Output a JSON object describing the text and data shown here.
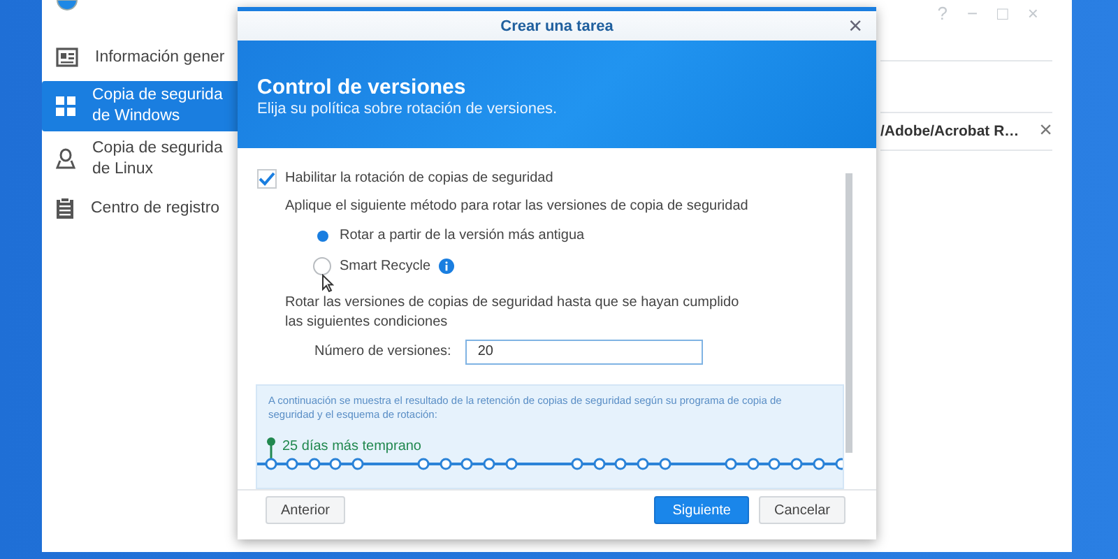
{
  "window": {
    "controls": [
      "?",
      "−",
      "□",
      "×"
    ]
  },
  "sidebar": {
    "items": [
      {
        "label": "Información gener",
        "kind": "card",
        "selected": false
      },
      {
        "label": "Copia de segurida\nde Windows",
        "kind": "windows",
        "selected": true
      },
      {
        "label": "Copia de segurida\nde Linux",
        "kind": "linux",
        "selected": false
      },
      {
        "label": "Centro de registro",
        "kind": "clipboard",
        "selected": false
      }
    ]
  },
  "main": {
    "rows": [
      {
        "path": "/Adobe/Acrobat R…"
      }
    ]
  },
  "dialog": {
    "title": "Crear una tarea",
    "close": "×",
    "banner": {
      "title": "Control de versiones",
      "subtitle": "Elija su política sobre rotación de versiones."
    },
    "enable": {
      "label": "Habilitar la rotación de copias de seguridad",
      "checked": true
    },
    "method_label": "Aplique el siguiente método para rotar las versiones de copia de seguridad",
    "methods": [
      {
        "label": "Rotar a partir de la versión más antigua",
        "selected": true,
        "info": false
      },
      {
        "label": "Smart Recycle",
        "selected": false,
        "info": true
      }
    ],
    "condition_text": "Rotar las versiones de copias de seguridad hasta que se hayan cumplido las siguientes condiciones",
    "versions": {
      "label": "Número de versiones:",
      "value": "20"
    },
    "preview": {
      "text": "A continuación se muestra el resultado de la retención de copias de seguridad según su programa de copia de seguridad y el esquema de rotación:",
      "marker": "25 días más temprano"
    },
    "buttons": [
      {
        "label": "Anterior",
        "kind": "secondary"
      },
      {
        "label": "Siguiente",
        "kind": "primary"
      },
      {
        "label": "Cancelar",
        "kind": "secondary"
      }
    ]
  }
}
